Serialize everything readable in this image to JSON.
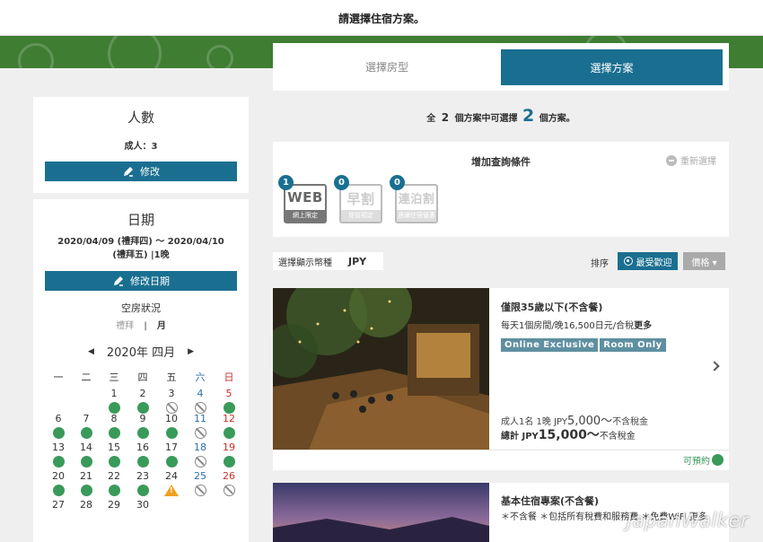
{
  "header": {
    "title": "請選擇住宿方案。"
  },
  "tabs": {
    "room": "選擇房型",
    "plan": "選擇方案"
  },
  "summary": {
    "prefix": "全",
    "total": "2",
    "middle": "個方案中可選擇",
    "available": "2",
    "suffix": "個方案。"
  },
  "people": {
    "title": "人數",
    "value": "成人：3",
    "edit_label": "修改"
  },
  "dates": {
    "title": "日期",
    "range": "2020/04/09 (禮拜四) 〜 2020/04/10 (禮拜五) |1晚",
    "edit_label": "修改日期",
    "vacancy_title": "空房狀況",
    "view_week": "禮拜",
    "view_sep": "|",
    "view_month": "月"
  },
  "calendar": {
    "month_label": "2020年 四月",
    "prev": "◀",
    "next": "▶",
    "weekdays": [
      "一",
      "二",
      "三",
      "四",
      "五",
      "六",
      "日"
    ],
    "days": [
      {
        "d": "1",
        "s": "ok"
      },
      {
        "d": "2",
        "s": "ok"
      },
      {
        "d": "3",
        "s": "no"
      },
      {
        "d": "4",
        "s": "no"
      },
      {
        "d": "5",
        "s": "ok"
      },
      {
        "d": "6",
        "s": "ok"
      },
      {
        "d": "7",
        "s": "ok"
      },
      {
        "d": "8",
        "s": "ok"
      },
      {
        "d": "9",
        "s": "ok"
      },
      {
        "d": "10",
        "s": "ok"
      },
      {
        "d": "11",
        "s": "no"
      },
      {
        "d": "12",
        "s": "ok"
      },
      {
        "d": "13",
        "s": "ok"
      },
      {
        "d": "14",
        "s": "ok"
      },
      {
        "d": "15",
        "s": "ok"
      },
      {
        "d": "16",
        "s": "ok"
      },
      {
        "d": "17",
        "s": "ok"
      },
      {
        "d": "18",
        "s": "no"
      },
      {
        "d": "19",
        "s": "ok"
      },
      {
        "d": "20",
        "s": "ok"
      },
      {
        "d": "21",
        "s": "ok"
      },
      {
        "d": "22",
        "s": "ok"
      },
      {
        "d": "23",
        "s": "ok"
      },
      {
        "d": "24",
        "s": "warn"
      },
      {
        "d": "25",
        "s": "no"
      },
      {
        "d": "26",
        "s": "no"
      },
      {
        "d": "27",
        "s": ""
      },
      {
        "d": "28",
        "s": ""
      },
      {
        "d": "29",
        "s": ""
      },
      {
        "d": "30",
        "s": ""
      }
    ]
  },
  "filter": {
    "title": "增加查詢條件",
    "reset_label": "重新選擇",
    "badges": [
      {
        "count": "1",
        "big": "WEB",
        "sub": "網上限定"
      },
      {
        "count": "0",
        "big": "早割",
        "sub": "提前預定"
      },
      {
        "count": "0",
        "big": "連泊割",
        "sub": "連續住宿優惠"
      }
    ]
  },
  "currency": {
    "label": "選擇顯示幣種",
    "value": "JPY"
  },
  "sort": {
    "label": "排序",
    "popular": "最受歡迎",
    "price": "價格 ▾"
  },
  "plans": [
    {
      "title": "僅限35歲以下(不含餐)",
      "desc": "每天1個房間/晚16,500日元/合稅",
      "desc_more": "更多",
      "tags": [
        "Online Exclusive",
        "Room Only"
      ],
      "per_person_prefix": "成人1名 1晚 JPY",
      "per_person_amount": "5,000〜",
      "per_person_suffix": "不含稅金",
      "total_label": "總計 JPY",
      "total_amount": "15,000〜",
      "total_suffix": "不含稅金",
      "status": "可預約"
    },
    {
      "title": "基本住宿專案(不含餐)",
      "desc": "＊不含餐 ＊包括所有稅費和服務費 ＊免費WiFi 更多"
    }
  ],
  "watermark": "JapanWalker"
}
